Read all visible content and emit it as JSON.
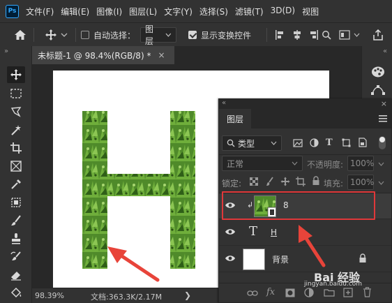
{
  "app": {
    "logo": "Ps"
  },
  "menu": [
    "文件(F)",
    "编辑(E)",
    "图像(I)",
    "图层(L)",
    "文字(Y)",
    "选择(S)",
    "滤镜(T)",
    "3D(D)",
    "视图"
  ],
  "options": {
    "auto_select_label": "自动选择：",
    "auto_select_checked": false,
    "auto_select_target": "图层",
    "show_transform_label": "显示变换控件",
    "show_transform_checked": true
  },
  "document": {
    "tab_title": "未标题-1 @ 98.4%(RGB/8) *",
    "tab_close": "×",
    "canvas_letter": "H"
  },
  "status": {
    "zoom": "98.39%",
    "doc_info": "文档:363.3K/2.17M",
    "nav_arrow": "❯"
  },
  "layers_panel": {
    "collapse_glyph": "«",
    "close_glyph": "×",
    "title": "图层",
    "filter_label": "类型",
    "blend_mode": "正常",
    "opacity_label": "不透明度:",
    "opacity_value": "100%",
    "lock_label": "锁定:",
    "fill_label": "填充:",
    "fill_value": "100%",
    "layers": [
      {
        "name": "8",
        "type": "image",
        "clipped": true,
        "selected": true,
        "visible": true
      },
      {
        "name": "H",
        "type": "text",
        "clipped": false,
        "selected": false,
        "visible": true
      },
      {
        "name": "背景",
        "type": "background",
        "clipped": false,
        "selected": false,
        "visible": true,
        "locked": true
      }
    ],
    "footer_icons": [
      "link-icon",
      "fx-icon",
      "mask-icon",
      "adjustment-icon",
      "group-icon",
      "new-layer-icon",
      "delete-icon"
    ],
    "fx_label": "fx"
  },
  "watermark": {
    "text": "Bai 经验",
    "subtext": "jingyan.baidu.com"
  },
  "colors": {
    "panel_bg": "#323232",
    "app_bg": "#282828",
    "highlight_border": "#e0383a",
    "arrow_red": "#e8443a",
    "grass_green": "#4f8a2a",
    "ps_blue": "#31a8ff"
  }
}
